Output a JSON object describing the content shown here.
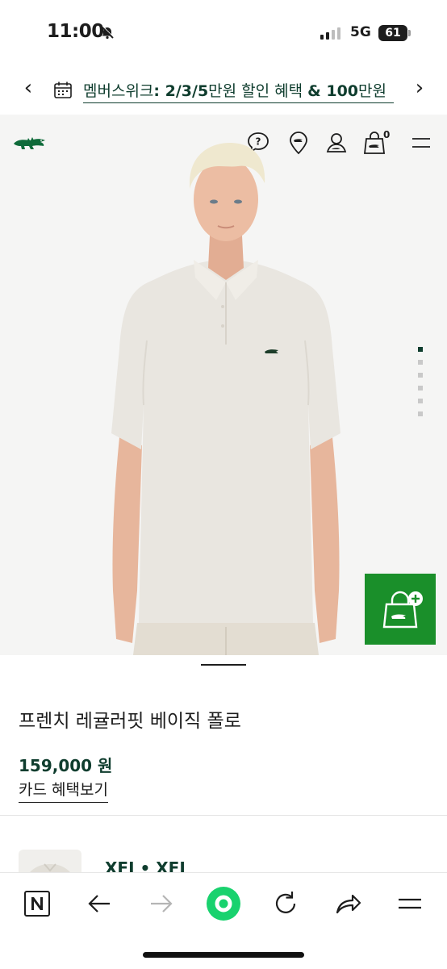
{
  "status": {
    "time": "11:00",
    "network": "5G",
    "battery": "61"
  },
  "promo": {
    "prefix": "멤버스위크",
    "bold1": ": 2/3/5",
    "mid": "만원 할인 혜택 ",
    "bold2": "& 100",
    "suffix": "만원"
  },
  "header": {
    "cart_count": "0"
  },
  "product": {
    "title": "프렌치 레귤러핏 베이직 폴로",
    "price": "159,000 원",
    "card_benefit": "카드 혜택보기",
    "brand_preview": "XFJ • XFJ"
  },
  "colors": {
    "brand_green": "#0f3d2e",
    "wish_green": "#1a8f2a"
  },
  "icons": [
    "chevron-left-icon",
    "calendar-icon",
    "chevron-right-icon",
    "crocodile-logo-icon",
    "help-icon",
    "store-locator-icon",
    "account-icon",
    "cart-icon",
    "menu-icon",
    "wishlist-add-icon",
    "naver-home-icon",
    "back-icon",
    "forward-icon",
    "green-dot-icon",
    "reload-icon",
    "share-icon",
    "tabs-menu-icon"
  ]
}
